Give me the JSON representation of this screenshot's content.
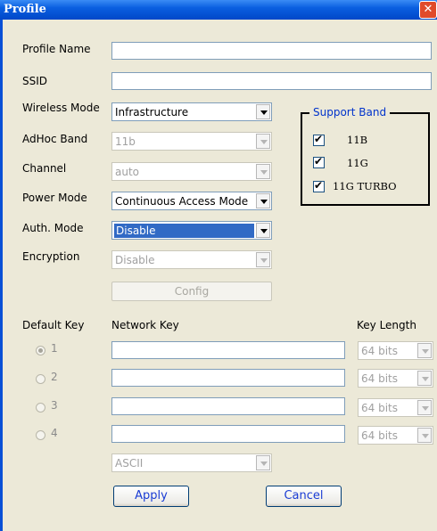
{
  "window": {
    "title": "Profile",
    "close_glyph": "✕"
  },
  "labels": {
    "profile_name": "Profile Name",
    "ssid": "SSID",
    "wireless_mode": "Wireless Mode",
    "adhoc_band": "AdHoc Band",
    "channel": "Channel",
    "power_mode": "Power Mode",
    "auth_mode": "Auth. Mode",
    "encryption": "Encryption"
  },
  "fields": {
    "profile_name": "",
    "ssid": ""
  },
  "selects": {
    "wireless_mode": "Infrastructure",
    "adhoc_band": "11b",
    "channel": "auto",
    "power_mode": "Continuous Access Mode",
    "auth_mode": "Disable",
    "encryption": "Disable",
    "key_format": "ASCII"
  },
  "support_band": {
    "title": "Support Band",
    "items": [
      {
        "label": "11B",
        "checked": true
      },
      {
        "label": "11G",
        "checked": true
      },
      {
        "label": "11G TURBO",
        "checked": true
      }
    ]
  },
  "config_button": "Config",
  "keys": {
    "default_key_header": "Default Key",
    "network_key_header": "Network Key",
    "key_length_header": "Key Length",
    "rows": [
      {
        "index": "1",
        "selected": true,
        "value": "",
        "length": "64 bits"
      },
      {
        "index": "2",
        "selected": false,
        "value": "",
        "length": "64 bits"
      },
      {
        "index": "3",
        "selected": false,
        "value": "",
        "length": "64 bits"
      },
      {
        "index": "4",
        "selected": false,
        "value": "",
        "length": "64 bits"
      }
    ]
  },
  "buttons": {
    "apply": "Apply",
    "cancel": "Cancel"
  }
}
